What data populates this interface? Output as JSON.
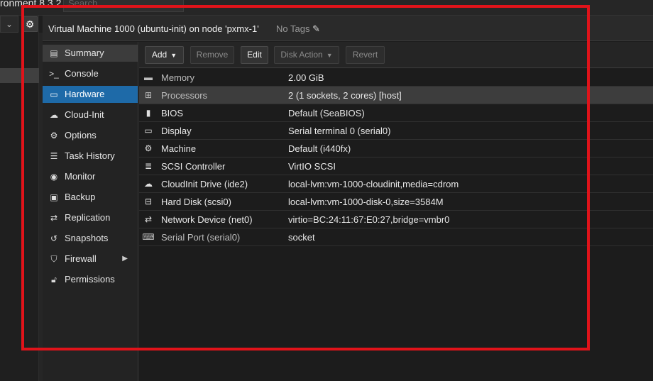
{
  "topbar": {
    "app_version": "ronment 8.3.2",
    "search_placeholder": "Search"
  },
  "tree": {
    "view_select_caret": "⌄",
    "gear_icon": "gear-icon"
  },
  "header": {
    "title": "Virtual Machine 1000 (ubuntu-init) on node 'pxmx-1'",
    "tags_label": "No Tags",
    "tags_icon": "pencil-icon"
  },
  "nav": {
    "items": [
      {
        "label": "Summary",
        "icon": "book-icon"
      },
      {
        "label": "Console",
        "icon": "terminal-icon"
      },
      {
        "label": "Hardware",
        "icon": "monitor-icon"
      },
      {
        "label": "Cloud-Init",
        "icon": "cloud-icon"
      },
      {
        "label": "Options",
        "icon": "gear-icon"
      },
      {
        "label": "Task History",
        "icon": "list-icon"
      },
      {
        "label": "Monitor",
        "icon": "eye-icon"
      },
      {
        "label": "Backup",
        "icon": "floppy-icon"
      },
      {
        "label": "Replication",
        "icon": "retweet-icon"
      },
      {
        "label": "Snapshots",
        "icon": "history-icon"
      },
      {
        "label": "Firewall",
        "icon": "shield-icon"
      },
      {
        "label": "Permissions",
        "icon": "unlock-icon"
      }
    ],
    "selected": "Hardware"
  },
  "toolbar": {
    "add": "Add",
    "remove": "Remove",
    "edit": "Edit",
    "disk_action": "Disk Action",
    "revert": "Revert"
  },
  "hardware": {
    "rows": [
      {
        "name": "Memory",
        "value": "2.00 GiB",
        "icon": "memory-icon"
      },
      {
        "name": "Processors",
        "value": "2 (1 sockets, 2 cores) [host]",
        "icon": "cpu-icon"
      },
      {
        "name": "BIOS",
        "value": "Default (SeaBIOS)",
        "icon": "chip-icon"
      },
      {
        "name": "Display",
        "value": "Serial terminal 0 (serial0)",
        "icon": "desktop-icon"
      },
      {
        "name": "Machine",
        "value": "Default (i440fx)",
        "icon": "cogs-icon"
      },
      {
        "name": "SCSI Controller",
        "value": "VirtIO SCSI",
        "icon": "database-icon"
      },
      {
        "name": "CloudInit Drive (ide2)",
        "value": "local-lvm:vm-1000-cloudinit,media=cdrom",
        "icon": "cloud-icon"
      },
      {
        "name": "Hard Disk (scsi0)",
        "value": "local-lvm:vm-1000-disk-0,size=3584M",
        "icon": "hdd-icon"
      },
      {
        "name": "Network Device (net0)",
        "value": "virtio=BC:24:11:67:E0:27,bridge=vmbr0",
        "icon": "exchange-icon"
      },
      {
        "name": "Serial Port (serial0)",
        "value": "socket",
        "icon": "keyboard-icon"
      }
    ],
    "selected": "Processors"
  },
  "colors": {
    "selection_blue": "#1e6aa8",
    "highlight_frame": "#e0131a"
  }
}
